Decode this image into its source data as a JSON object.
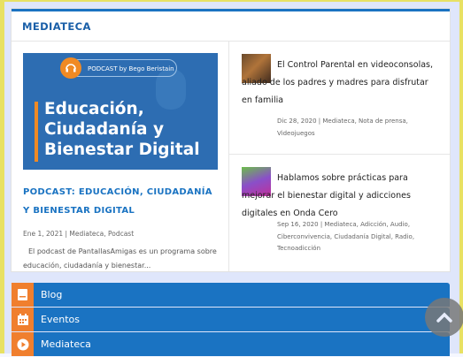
{
  "widget": {
    "title": "MEDIATECA",
    "featured": {
      "banner_podcast_label": "PODCAST by Bego Beristain",
      "banner_lines": [
        "Educación,",
        "Ciudadanía y",
        "Bienestar Digital"
      ],
      "title": "PODCAST: EDUCACIÓN, CIUDADANÍA Y BIENESTAR DIGITAL",
      "meta": "Ene 1, 2021 | Mediateca, Podcast",
      "excerpt": "El podcast de PantallasAmigas es un programa sobre educación, ciudadanía y bienestar..."
    },
    "news": [
      {
        "title": "El Control Parental en videoconsolas, aliado de los padres y madres para disfrutar en familia",
        "meta": "Dic 28, 2020 | Mediateca, Nota de prensa, Videojuegos"
      },
      {
        "title": "Hablamos sobre prácticas para mejorar el bienestar digital y adicciones digitales en Onda Cero",
        "meta": "Sep 16, 2020 | Mediateca, Adicción, Audio, Ciberconvivencia, Ciudadanía Digital, Radio, Tecnoadicción"
      }
    ]
  },
  "menu": [
    {
      "label": "Blog",
      "icon": "document-icon"
    },
    {
      "label": "Eventos",
      "icon": "calendar-icon"
    },
    {
      "label": "Mediateca",
      "icon": "play-icon"
    }
  ],
  "colors": {
    "accent": "#1a73c2",
    "icon_bg": "#f07f2e",
    "banner_bg": "#2d6db2"
  }
}
